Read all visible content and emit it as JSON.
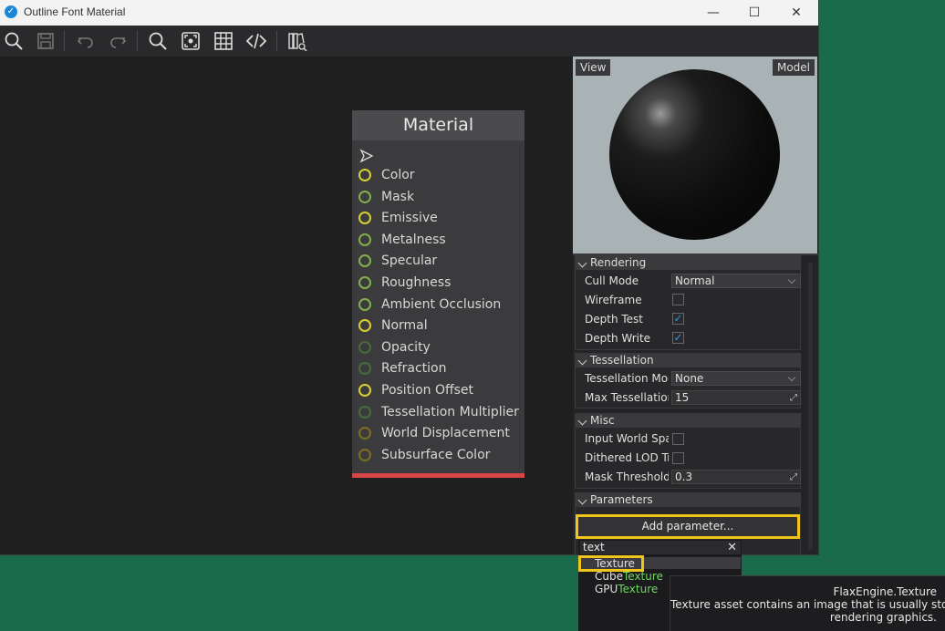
{
  "window": {
    "title": "Outline Font Material"
  },
  "titlebar_buttons": {
    "minimize": "—",
    "maximize": "☐",
    "close": "✕"
  },
  "toolbar": {
    "icons": [
      "search-icon",
      "save-icon",
      "undo-icon",
      "redo-icon",
      "find-icon",
      "fit-view-icon",
      "grid-icon",
      "code-icon",
      "docs-icon"
    ]
  },
  "node": {
    "title": "Material",
    "pins": [
      {
        "label": "Color",
        "color": "#d8d030"
      },
      {
        "label": "Mask",
        "color": "#7fb04a"
      },
      {
        "label": "Emissive",
        "color": "#d8d030"
      },
      {
        "label": "Metalness",
        "color": "#7fb04a"
      },
      {
        "label": "Specular",
        "color": "#7fb04a"
      },
      {
        "label": "Roughness",
        "color": "#7fb04a"
      },
      {
        "label": "Ambient Occlusion",
        "color": "#7fb04a"
      },
      {
        "label": "Normal",
        "color": "#d8d030"
      },
      {
        "label": "Opacity",
        "color": "#4a6a3a"
      },
      {
        "label": "Refraction",
        "color": "#4a6a3a"
      },
      {
        "label": "Position Offset",
        "color": "#d8d030"
      },
      {
        "label": "Tessellation Multiplier",
        "color": "#4a6a3a"
      },
      {
        "label": "World Displacement",
        "color": "#7a7020"
      },
      {
        "label": "Subsurface Color",
        "color": "#7a7020"
      }
    ],
    "footer_color": "#d84545"
  },
  "preview": {
    "view_label": "View",
    "model_label": "Model"
  },
  "properties": {
    "rendering": {
      "header": "Rendering",
      "cull_mode_label": "Cull Mode",
      "cull_mode_value": "Normal",
      "wireframe_label": "Wireframe",
      "wireframe_checked": false,
      "depth_test_label": "Depth Test",
      "depth_test_checked": true,
      "depth_write_label": "Depth Write",
      "depth_write_checked": true
    },
    "tessellation": {
      "header": "Tessellation",
      "mode_label": "Tessellation Mod",
      "mode_value": "None",
      "max_label": "Max Tessellation",
      "max_value": "15"
    },
    "misc": {
      "header": "Misc",
      "input_world_space_label": "Input World Spac",
      "input_world_space_checked": false,
      "dithered_lod_label": "Dithered LOD Tra",
      "dithered_lod_checked": false,
      "mask_threshold_label": "Mask Threshold",
      "mask_threshold_value": "0.3"
    },
    "parameters": {
      "header": "Parameters",
      "add_button": "Add parameter..."
    }
  },
  "popup": {
    "search_value": "text",
    "clear_glyph": "✕",
    "items": [
      {
        "pre": "",
        "match": "Texture",
        "post": "",
        "selected": true
      },
      {
        "pre": "Cube",
        "match": "Texture",
        "post": "",
        "selected": false
      },
      {
        "pre": "GPU",
        "match": "Texture",
        "post": "",
        "selected": false
      }
    ]
  },
  "tooltip": {
    "title": "FlaxEngine.Texture",
    "description_line1": "Texture asset contains an image that is usually stored",
    "description_line2": "rendering graphics."
  },
  "check_glyph": "✓",
  "resize_glyph": "⤢"
}
